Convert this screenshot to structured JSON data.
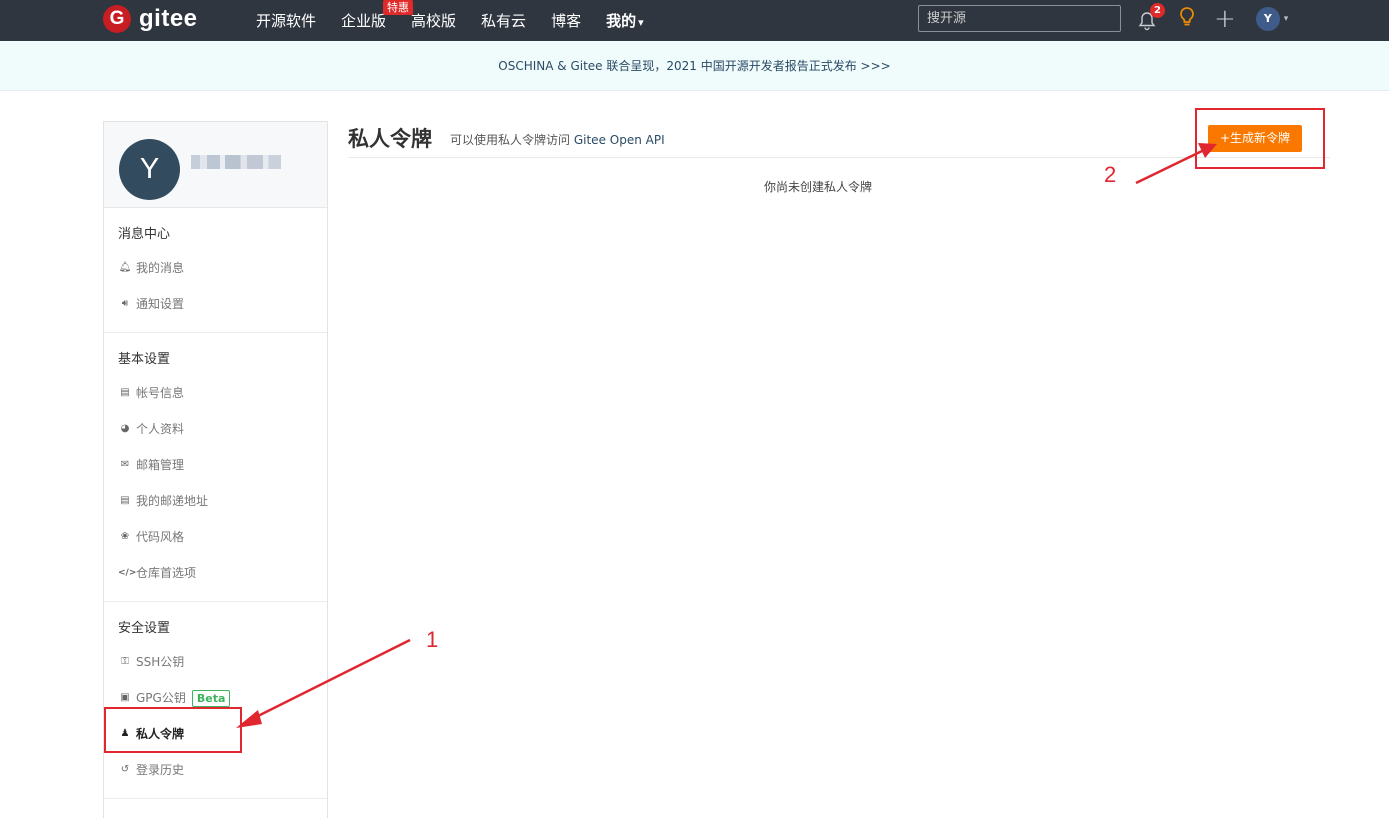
{
  "brand": {
    "logo_letter": "G",
    "name": "gitee"
  },
  "nav": {
    "items": [
      "开源软件",
      "企业版",
      "高校版",
      "私有云",
      "博客",
      "我的"
    ],
    "hot_badge": "特惠",
    "mine_caret": "▾"
  },
  "search": {
    "placeholder": "搜开源"
  },
  "topicons": {
    "notification_count": "2",
    "user_initial": "Y",
    "user_caret": "▾"
  },
  "banner": {
    "text": "OSCHINA & Gitee 联合呈现，2021 中国开源开发者报告正式发布 >>>"
  },
  "profile": {
    "avatar_initial": "Y"
  },
  "sidebar": {
    "sections": [
      {
        "title": "消息中心",
        "items": [
          {
            "label": "我的消息",
            "icon": "bell-icon"
          },
          {
            "label": "通知设置",
            "icon": "speaker-icon"
          }
        ]
      },
      {
        "title": "基本设置",
        "items": [
          {
            "label": "帐号信息",
            "icon": "id-card-icon"
          },
          {
            "label": "个人资料",
            "icon": "user-icon"
          },
          {
            "label": "邮箱管理",
            "icon": "envelope-icon"
          },
          {
            "label": "我的邮递地址",
            "icon": "address-card-icon"
          },
          {
            "label": "代码风格",
            "icon": "palette-icon"
          },
          {
            "label": "仓库首选项",
            "icon": "code-icon"
          }
        ]
      },
      {
        "title": "安全设置",
        "items": [
          {
            "label": "SSH公钥",
            "icon": "key-icon"
          },
          {
            "label": "GPG公钥",
            "icon": "lock-icon",
            "badge": "Beta"
          },
          {
            "label": "私人令牌",
            "icon": "user-secret-icon",
            "active": true
          },
          {
            "label": "登录历史",
            "icon": "history-icon"
          }
        ]
      }
    ]
  },
  "main": {
    "title": "私人令牌",
    "subtitle": "可以使用私人令牌访问",
    "api_text": "Gitee Open API",
    "new_token_button": "+生成新令牌",
    "empty_text": "你尚未创建私人令牌"
  },
  "annotations": {
    "label_1": "1",
    "label_2": "2",
    "color": "#e0262f"
  },
  "colors": {
    "topbar": "#2f3640",
    "accent": "#fa7800",
    "brand": "#c71d23"
  }
}
